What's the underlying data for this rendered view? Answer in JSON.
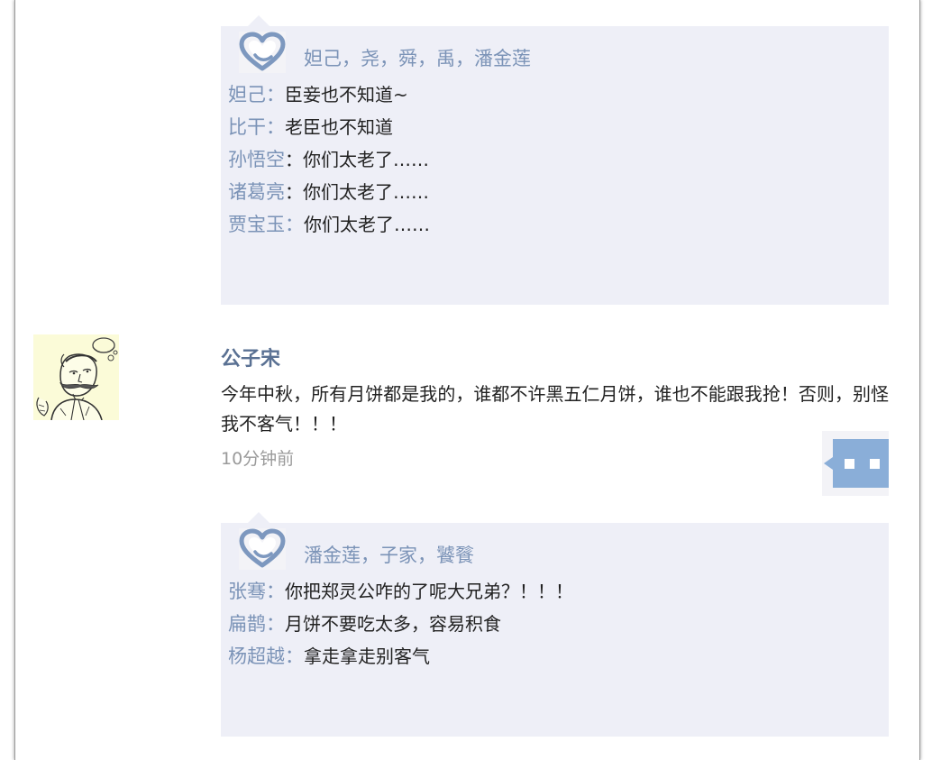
{
  "feed": {
    "posts": [
      {
        "likes": {
          "names": "妲己，尧，舜，禹，潘金莲"
        },
        "replies": [
          {
            "name": "妲己：",
            "text": "臣妾也不知道~"
          },
          {
            "name": "比干：",
            "text": "老臣也不知道"
          },
          {
            "name": "孙悟空",
            "text": "：你们太老了……"
          },
          {
            "name": "诸葛亮",
            "text": "：你们太老了……"
          },
          {
            "name": "贾宝玉：",
            "text": "你们太老了……"
          }
        ]
      },
      {
        "author": "公子宋",
        "content": "今年中秋，所有月饼都是我的，谁都不许黑五仁月饼，谁也不能跟我抢！否则，别怪我不客气！！！",
        "time": "10分钟前",
        "avatar_icon": "cartoon-man-portrait-icon",
        "comment_icon": "speech-bubble-icon",
        "likes": {
          "names": "潘金莲，子家，饕餮"
        },
        "replies": [
          {
            "name": "张骞：",
            "text": "你把郑灵公咋的了呢大兄弟？！！！"
          },
          {
            "name": "扁鹊：",
            "text": "月饼不要吃太多，容易积食"
          },
          {
            "name": "杨超越：",
            "text": "拿走拿走别客气"
          }
        ]
      }
    ]
  },
  "colors": {
    "name_link": "#7b93b7",
    "author": "#5a7193",
    "box_bg": "#eeeff7",
    "heart": "#7d98bf",
    "comment_button": "#8aaed8",
    "time": "#9a9a9a"
  }
}
